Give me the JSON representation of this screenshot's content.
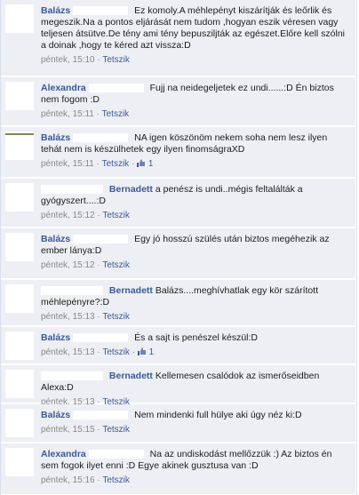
{
  "comments": [
    {
      "author": "Balázs",
      "text": "Ez komoly.A méhlepényt kiszárítják és leőrlik és megeszik.Na a pontos eljárását nem tudom ,hogyan eszik véresen vagy teljesen átsütve.De tény ami tény bepusziljták az egészet.Előre kell szólni a doinak ,hogy te kéred azt vissza:D",
      "time": "péntek, 15:10",
      "like": "Tetszik"
    },
    {
      "author": "Alexandra",
      "text": "Fujj na neidegeljetek ez undi......:D Én biztos nem fogom :D",
      "time": "péntek, 15:11",
      "like": "Tetszik"
    },
    {
      "author": "Balázs",
      "text": "NA igen köszönöm nekem soha nem lesz ilyen tehát nem is készülhetek egy ilyen finomságraXD",
      "time": "péntek, 15:11",
      "like": "Tetszik",
      "likes": "1"
    },
    {
      "author": "Bernadett",
      "text": "a penész is undi..mégis feltalálták a gyógyszert....:D",
      "time": "péntek, 15:12",
      "like": "Tetszik"
    },
    {
      "author": "Balázs",
      "text": "Egy jó hosszú szülés után biztos megéhezik az ember lánya:D",
      "time": "péntek, 15:12",
      "like": "Tetszik"
    },
    {
      "author": "Bernadett",
      "text": "Balázs....meghívhatlak egy kör szárított méhlepényre?:D",
      "time": "péntek, 15:13",
      "like": "Tetszik"
    },
    {
      "author": "Balázs",
      "text": "És a sajt is penészel készül:D",
      "time": "péntek, 15:13",
      "like": "Tetszik",
      "likes": "1"
    },
    {
      "author": "Bernadett",
      "text": "Kellemesen csalódok az ismerőseidben Alexa:D",
      "time": "péntek, 15:13",
      "like": "Tetszik"
    },
    {
      "author": "Balázs",
      "text": "Nem mindenki full hülye aki úgy néz ki:D",
      "time": "péntek, 15:15",
      "like": "Tetszik"
    },
    {
      "author": "Alexandra",
      "text": "Na az undiskodást mellőzzük :) Az biztos én sem fogok ilyet enni :D Egye akinek gusztusa van :D",
      "time": "péntek, 15:16",
      "like": "Tetszik"
    }
  ],
  "colors": {
    "link": "#3b5998",
    "background": "#edeff4",
    "meta": "#888888"
  },
  "icons": {
    "like": "thumbs-up-icon"
  }
}
